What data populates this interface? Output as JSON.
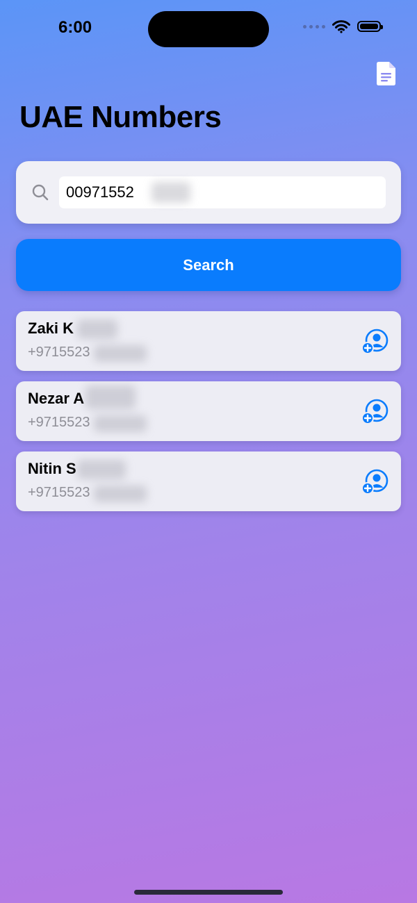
{
  "status_bar": {
    "time": "6:00"
  },
  "toolbar": {
    "doc_icon": "doc-text-icon"
  },
  "page": {
    "title": "UAE Numbers"
  },
  "search": {
    "icon": "search-icon",
    "value": "00971552",
    "button_label": "Search"
  },
  "contacts": [
    {
      "name": "Zaki K",
      "phone": "+9715523",
      "icon": "add-contact-icon"
    },
    {
      "name": "Nezar A",
      "phone": "+9715523",
      "icon": "add-contact-icon"
    },
    {
      "name": "Nitin S",
      "phone": "+9715523",
      "icon": "add-contact-icon"
    }
  ],
  "colors": {
    "accent": "#0a7cfd",
    "gradient_top": "#5b95f7",
    "gradient_bottom": "#b878e3",
    "card": "#ededf4",
    "secondary_text": "#8e8e96"
  }
}
